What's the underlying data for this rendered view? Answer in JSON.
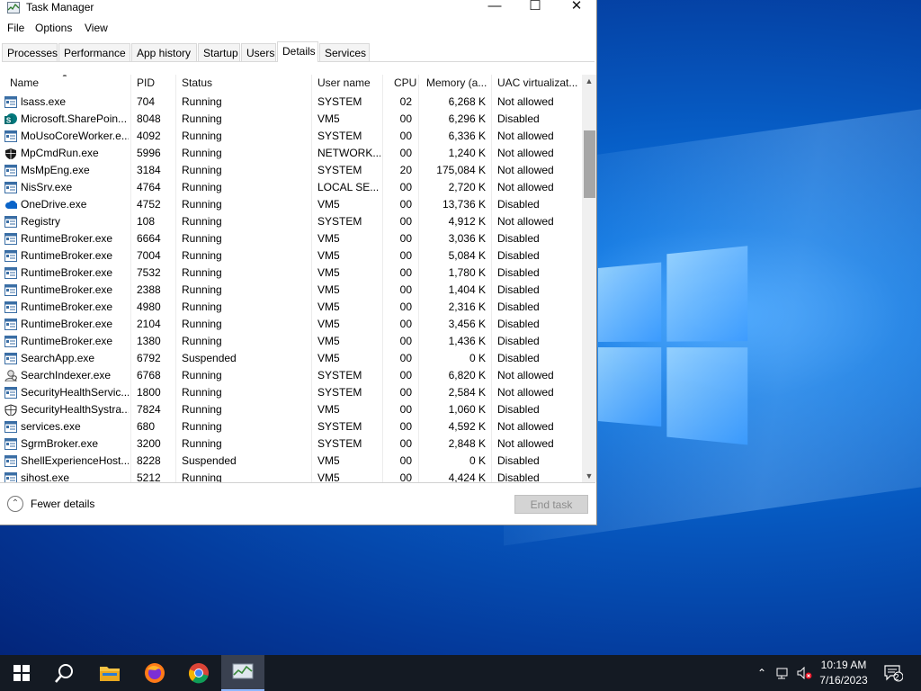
{
  "window": {
    "title": "Task Manager"
  },
  "menu": [
    "File",
    "Options",
    "View"
  ],
  "tabs": [
    "Processes",
    "Performance",
    "App history",
    "Startup",
    "Users",
    "Details",
    "Services"
  ],
  "active_tab": "Details",
  "columns": [
    "Name",
    "PID",
    "Status",
    "User name",
    "CPU",
    "Memory (a...",
    "UAC virtualizat..."
  ],
  "rows": [
    {
      "name": "lsass.exe",
      "pid": "704",
      "status": "Running",
      "user": "SYSTEM",
      "cpu": "02",
      "mem": "6,268 K",
      "uac": "Not allowed",
      "icon": "generic"
    },
    {
      "name": "Microsoft.SharePoin...",
      "pid": "8048",
      "status": "Running",
      "user": "VM5",
      "cpu": "00",
      "mem": "6,296 K",
      "uac": "Disabled",
      "icon": "sharepoint"
    },
    {
      "name": "MoUsoCoreWorker.e...",
      "pid": "4092",
      "status": "Running",
      "user": "SYSTEM",
      "cpu": "00",
      "mem": "6,336 K",
      "uac": "Not allowed",
      "icon": "generic"
    },
    {
      "name": "MpCmdRun.exe",
      "pid": "5996",
      "status": "Running",
      "user": "NETWORK...",
      "cpu": "00",
      "mem": "1,240 K",
      "uac": "Not allowed",
      "icon": "shield-dark"
    },
    {
      "name": "MsMpEng.exe",
      "pid": "3184",
      "status": "Running",
      "user": "SYSTEM",
      "cpu": "20",
      "mem": "175,084 K",
      "uac": "Not allowed",
      "icon": "generic"
    },
    {
      "name": "NisSrv.exe",
      "pid": "4764",
      "status": "Running",
      "user": "LOCAL SE...",
      "cpu": "00",
      "mem": "2,720 K",
      "uac": "Not allowed",
      "icon": "generic"
    },
    {
      "name": "OneDrive.exe",
      "pid": "4752",
      "status": "Running",
      "user": "VM5",
      "cpu": "00",
      "mem": "13,736 K",
      "uac": "Disabled",
      "icon": "cloud"
    },
    {
      "name": "Registry",
      "pid": "108",
      "status": "Running",
      "user": "SYSTEM",
      "cpu": "00",
      "mem": "4,912 K",
      "uac": "Not allowed",
      "icon": "generic"
    },
    {
      "name": "RuntimeBroker.exe",
      "pid": "6664",
      "status": "Running",
      "user": "VM5",
      "cpu": "00",
      "mem": "3,036 K",
      "uac": "Disabled",
      "icon": "generic"
    },
    {
      "name": "RuntimeBroker.exe",
      "pid": "7004",
      "status": "Running",
      "user": "VM5",
      "cpu": "00",
      "mem": "5,084 K",
      "uac": "Disabled",
      "icon": "generic"
    },
    {
      "name": "RuntimeBroker.exe",
      "pid": "7532",
      "status": "Running",
      "user": "VM5",
      "cpu": "00",
      "mem": "1,780 K",
      "uac": "Disabled",
      "icon": "generic"
    },
    {
      "name": "RuntimeBroker.exe",
      "pid": "2388",
      "status": "Running",
      "user": "VM5",
      "cpu": "00",
      "mem": "1,404 K",
      "uac": "Disabled",
      "icon": "generic"
    },
    {
      "name": "RuntimeBroker.exe",
      "pid": "4980",
      "status": "Running",
      "user": "VM5",
      "cpu": "00",
      "mem": "2,316 K",
      "uac": "Disabled",
      "icon": "generic"
    },
    {
      "name": "RuntimeBroker.exe",
      "pid": "2104",
      "status": "Running",
      "user": "VM5",
      "cpu": "00",
      "mem": "3,456 K",
      "uac": "Disabled",
      "icon": "generic"
    },
    {
      "name": "RuntimeBroker.exe",
      "pid": "1380",
      "status": "Running",
      "user": "VM5",
      "cpu": "00",
      "mem": "1,436 K",
      "uac": "Disabled",
      "icon": "generic"
    },
    {
      "name": "SearchApp.exe",
      "pid": "6792",
      "status": "Suspended",
      "user": "VM5",
      "cpu": "00",
      "mem": "0 K",
      "uac": "Disabled",
      "icon": "generic"
    },
    {
      "name": "SearchIndexer.exe",
      "pid": "6768",
      "status": "Running",
      "user": "SYSTEM",
      "cpu": "00",
      "mem": "6,820 K",
      "uac": "Not allowed",
      "icon": "search-person"
    },
    {
      "name": "SecurityHealthServic...",
      "pid": "1800",
      "status": "Running",
      "user": "SYSTEM",
      "cpu": "00",
      "mem": "2,584 K",
      "uac": "Not allowed",
      "icon": "generic"
    },
    {
      "name": "SecurityHealthSystra...",
      "pid": "7824",
      "status": "Running",
      "user": "VM5",
      "cpu": "00",
      "mem": "1,060 K",
      "uac": "Disabled",
      "icon": "shield-outline"
    },
    {
      "name": "services.exe",
      "pid": "680",
      "status": "Running",
      "user": "SYSTEM",
      "cpu": "00",
      "mem": "4,592 K",
      "uac": "Not allowed",
      "icon": "generic"
    },
    {
      "name": "SgrmBroker.exe",
      "pid": "3200",
      "status": "Running",
      "user": "SYSTEM",
      "cpu": "00",
      "mem": "2,848 K",
      "uac": "Not allowed",
      "icon": "generic"
    },
    {
      "name": "ShellExperienceHost....",
      "pid": "8228",
      "status": "Suspended",
      "user": "VM5",
      "cpu": "00",
      "mem": "0 K",
      "uac": "Disabled",
      "icon": "generic"
    },
    {
      "name": "sihost.exe",
      "pid": "5212",
      "status": "Running",
      "user": "VM5",
      "cpu": "00",
      "mem": "4,424 K",
      "uac": "Disabled",
      "icon": "generic"
    }
  ],
  "footer": {
    "fewer_details": "Fewer details",
    "end_task": "End task"
  },
  "taskbar": {
    "icons": [
      "windows-start-icon",
      "search-icon",
      "file-explorer-icon",
      "firefox-icon",
      "chrome-icon",
      "task-manager-icon"
    ],
    "time": "10:19 AM",
    "date": "7/16/2023",
    "notification_count": "2"
  },
  "colors": {
    "accent": "#0078d7",
    "taskbar": "#141a23",
    "desktop": "#0656bd"
  }
}
